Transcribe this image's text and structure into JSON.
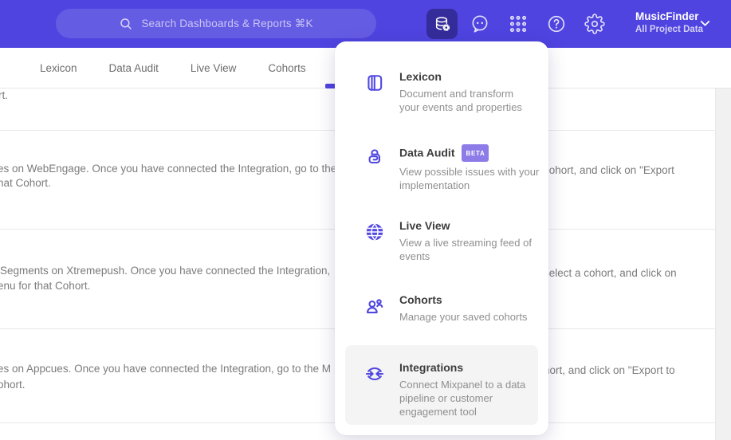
{
  "header": {
    "search_placeholder": "Search Dashboards & Reports ⌘K",
    "project_name": "MusicFinder",
    "project_subtitle": "All Project Data"
  },
  "tabs": {
    "items": [
      {
        "label": "Lexicon"
      },
      {
        "label": "Data Audit"
      },
      {
        "label": "Live View"
      },
      {
        "label": "Cohorts"
      }
    ]
  },
  "menu": {
    "items": [
      {
        "title": "Lexicon",
        "desc": "Document and transform\nyour events and properties",
        "icon": "book-icon"
      },
      {
        "title": "Data Audit",
        "badge": "BETA",
        "desc": "View possible issues with your\nimplementation",
        "icon": "audit-lock-icon"
      },
      {
        "title": "Live View",
        "desc": "View a live streaming feed of\nevents",
        "icon": "globe-icon"
      },
      {
        "title": "Cohorts",
        "desc": "Manage your saved cohorts",
        "icon": "people-icon"
      },
      {
        "title": "Integrations",
        "desc": "Connect Mixpanel to a data\npipeline or customer\nengagement tool",
        "icon": "sync-arrows-icon",
        "highlighted": true
      }
    ]
  },
  "content": {
    "rows": [
      {
        "line1_left": "rt."
      },
      {
        "line1_left": "es on WebEngage. Once you have connected the Integration, go to the",
        "line1_right": "cohort, and click on \"Export",
        "line2_left": "hat Cohort."
      },
      {
        "line1_left": "Segments on Xtremepush. Once you have connected the Integration,",
        "line1_right": "select a cohort, and click on",
        "line2_left": "enu for that Cohort."
      },
      {
        "line1_left": "es on Appcues. Once you have connected the Integration, go to the M",
        "line1_right": "hort, and click on \"Export to",
        "line2_left": "ohort."
      }
    ]
  },
  "colors": {
    "header_bg": "#4F44E0",
    "accent": "#4F44E0",
    "active_icon_bg": "#352C9B",
    "badge_bg": "#8D7CE8",
    "hover_bg": "#F4F4F4"
  }
}
